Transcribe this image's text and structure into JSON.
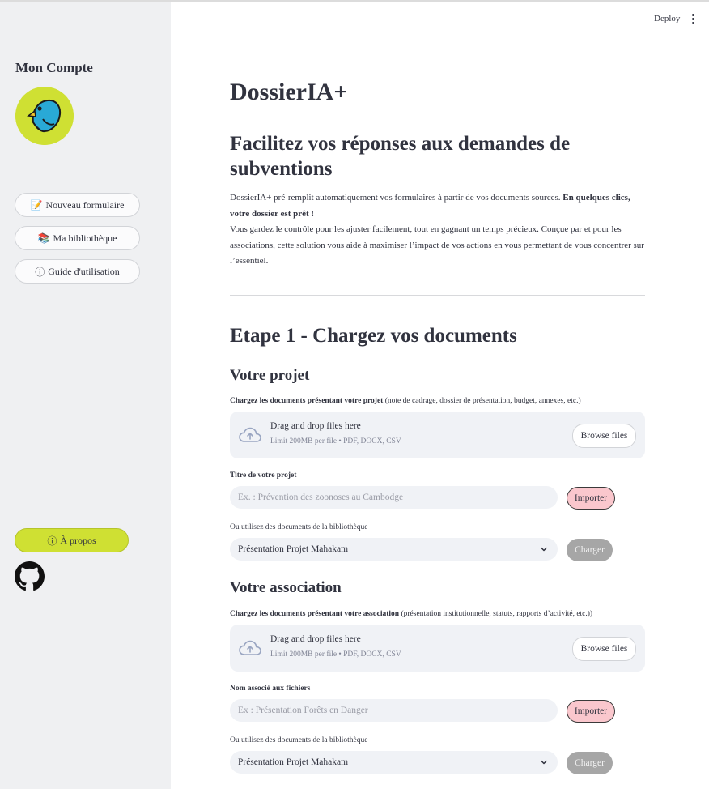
{
  "header": {
    "deploy_label": "Deploy",
    "menu_icon": "kebab-menu-icon"
  },
  "sidebar": {
    "title": "Mon Compte",
    "avatar_icon": "bird-avatar-icon",
    "avatar_color": "#cfe033",
    "buttons": [
      {
        "icon": "📝",
        "label": "Nouveau formulaire"
      },
      {
        "icon": "📚",
        "label": "Ma bibliothèque"
      },
      {
        "icon": "ⓘ",
        "label": "Guide d'utilisation"
      }
    ],
    "about": {
      "icon": "ⓘ",
      "label": "À propos"
    },
    "github_icon": "github-icon"
  },
  "main": {
    "app_title": "DossierIA+",
    "subtitle": "Facilitez vos réponses aux demandes de subventions",
    "intro": {
      "p1_text": "DossierIA+ pré-remplit automatiquement vos formulaires à partir de vos documents sources. ",
      "p1_bold": "En quelques clics, votre dossier est prêt !",
      "p2": "Vous gardez le contrôle pour les ajuster facilement, tout en gagnant un temps précieux. Conçue par et pour les associations, cette solution vous aide à maximiser l’impact de vos actions en vous permettant de vous concentrer sur l’essentiel."
    },
    "step_title": "Etape 1 - Chargez vos documents",
    "projet": {
      "title": "Votre projet",
      "upload_label_bold": "Chargez les documents présentant votre projet",
      "upload_label_rest": " (note de cadrage, dossier de présentation, budget, annexes, etc.)",
      "dropzone_main": "Drag and drop files here",
      "dropzone_sub": "Limit 200MB per file • PDF, DOCX, CSV",
      "browse_label": "Browse files",
      "name_label": "Titre de votre projet",
      "name_placeholder": "Ex. : Prévention des zoonoses au Cambodge",
      "import_label": "Importer",
      "library_label": "Ou utilisez des documents de la bibliothèque",
      "select_value": "Présentation Projet Mahakam",
      "charger_label": "Charger"
    },
    "association": {
      "title": "Votre association",
      "upload_label_bold": "Chargez les documents présentant votre association",
      "upload_label_rest": " (présentation institutionnelle, statuts, rapports d’activité, etc.))",
      "dropzone_main": "Drag and drop files here",
      "dropzone_sub": "Limit 200MB per file • PDF, DOCX, CSV",
      "browse_label": "Browse files",
      "name_label": "Nom associé aux fichiers",
      "name_placeholder": "Ex : Présentation Forêts en Danger",
      "import_label": "Importer",
      "library_label": "Ou utilisez des documents de la bibliothèque",
      "select_value": "Présentation Projet Mahakam",
      "charger_label": "Charger"
    }
  },
  "colors": {
    "accent_green": "#cfe033",
    "import_pink": "#fac7cd",
    "charger_grey": "#a6a6a6",
    "sidebar_bg": "#eff0f2"
  }
}
